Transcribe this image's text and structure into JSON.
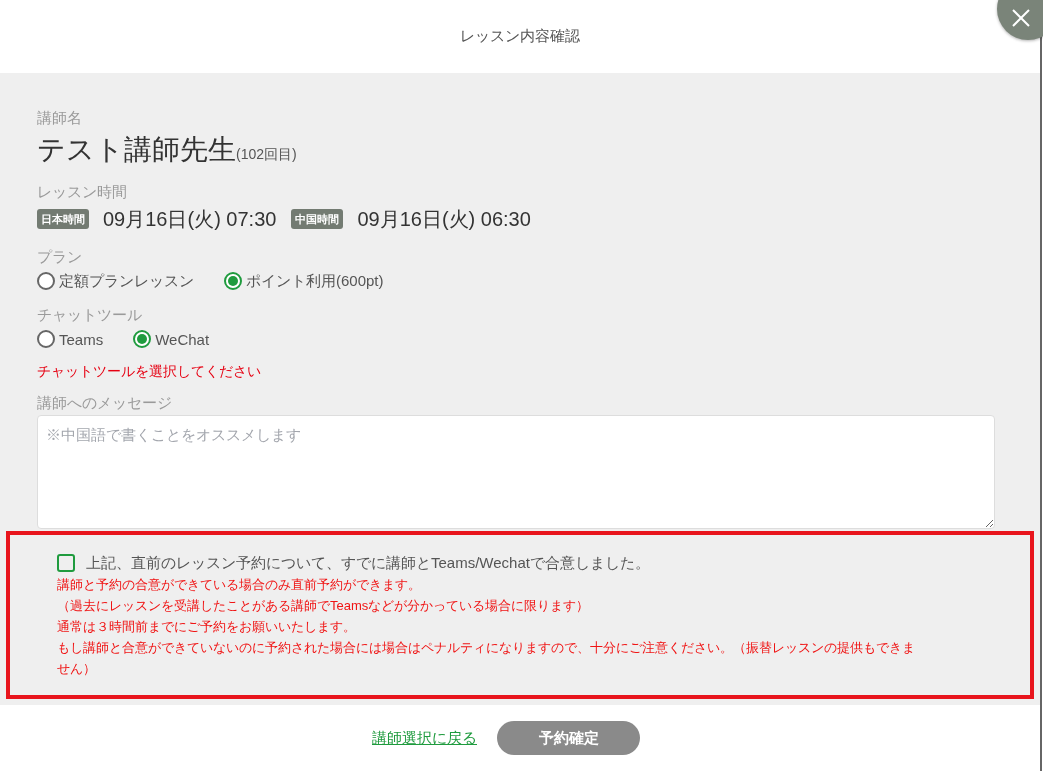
{
  "dialog": {
    "title": "レッスン内容確認"
  },
  "teacher": {
    "label": "講師名",
    "name": "テスト講師先生",
    "count": "(102回目)"
  },
  "lesson_time": {
    "label": "レッスン時間",
    "times": [
      {
        "badge": "日本時間",
        "value": "09月16日(火) 07:30"
      },
      {
        "badge": "中国時間",
        "value": "09月16日(火) 06:30"
      }
    ]
  },
  "plan": {
    "label": "プラン",
    "options": [
      {
        "label": "定額プランレッスン",
        "selected": false
      },
      {
        "label": "ポイント利用(600pt)",
        "selected": true
      }
    ]
  },
  "chat_tool": {
    "label": "チャットツール",
    "options": [
      {
        "label": "Teams",
        "selected": false
      },
      {
        "label": "WeChat",
        "selected": true
      }
    ],
    "error": "チャットツールを選択してください"
  },
  "message": {
    "label": "講師へのメッセージ",
    "placeholder": "※中国語で書くことをオススメします"
  },
  "agreement": {
    "checked": false,
    "label": "上記、直前のレッスン予約について、すでに講師とTeams/Wechatで合意しました。",
    "notes": [
      "講師と予約の合意ができている場合のみ直前予約ができます。",
      "（過去にレッスンを受講したことがある講師でTeamsなどが分かっている場合に限ります）",
      "通常は３時間前までにご予約をお願いいたします。",
      "もし講師と合意ができていないのに予約された場合には場合はペナルティになりますので、十分にご注意ください。（振替レッスンの提供もできません）"
    ]
  },
  "footer": {
    "back_link": "講師選択に戻る",
    "confirm_button": "予約確定"
  }
}
